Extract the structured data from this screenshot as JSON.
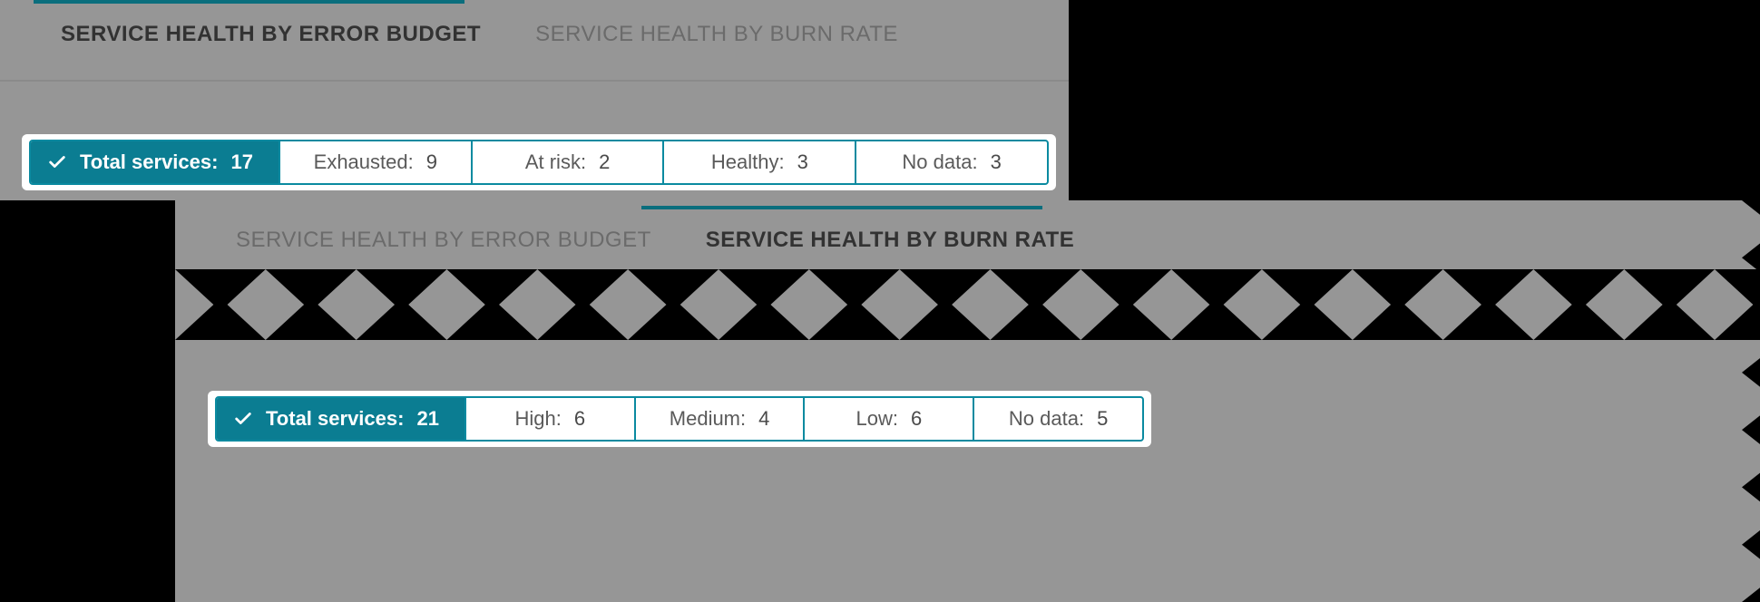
{
  "panel1": {
    "tabs": {
      "error_budget": "SERVICE HEALTH BY ERROR BUDGET",
      "burn_rate": "SERVICE HEALTH BY BURN RATE"
    },
    "summary": {
      "total_label": "Total services",
      "total_value": "17",
      "cells": [
        {
          "label": "Exhausted",
          "value": "9"
        },
        {
          "label": "At risk",
          "value": "2"
        },
        {
          "label": "Healthy",
          "value": "3"
        },
        {
          "label": "No data",
          "value": "3"
        }
      ]
    }
  },
  "panel2": {
    "tabs": {
      "error_budget": "SERVICE HEALTH BY ERROR BUDGET",
      "burn_rate": "SERVICE HEALTH BY BURN RATE"
    },
    "summary": {
      "total_label": "Total services",
      "total_value": "21",
      "cells": [
        {
          "label": "High",
          "value": "6"
        },
        {
          "label": "Medium",
          "value": "4"
        },
        {
          "label": "Low",
          "value": "6"
        },
        {
          "label": "No data",
          "value": "5"
        }
      ]
    }
  }
}
